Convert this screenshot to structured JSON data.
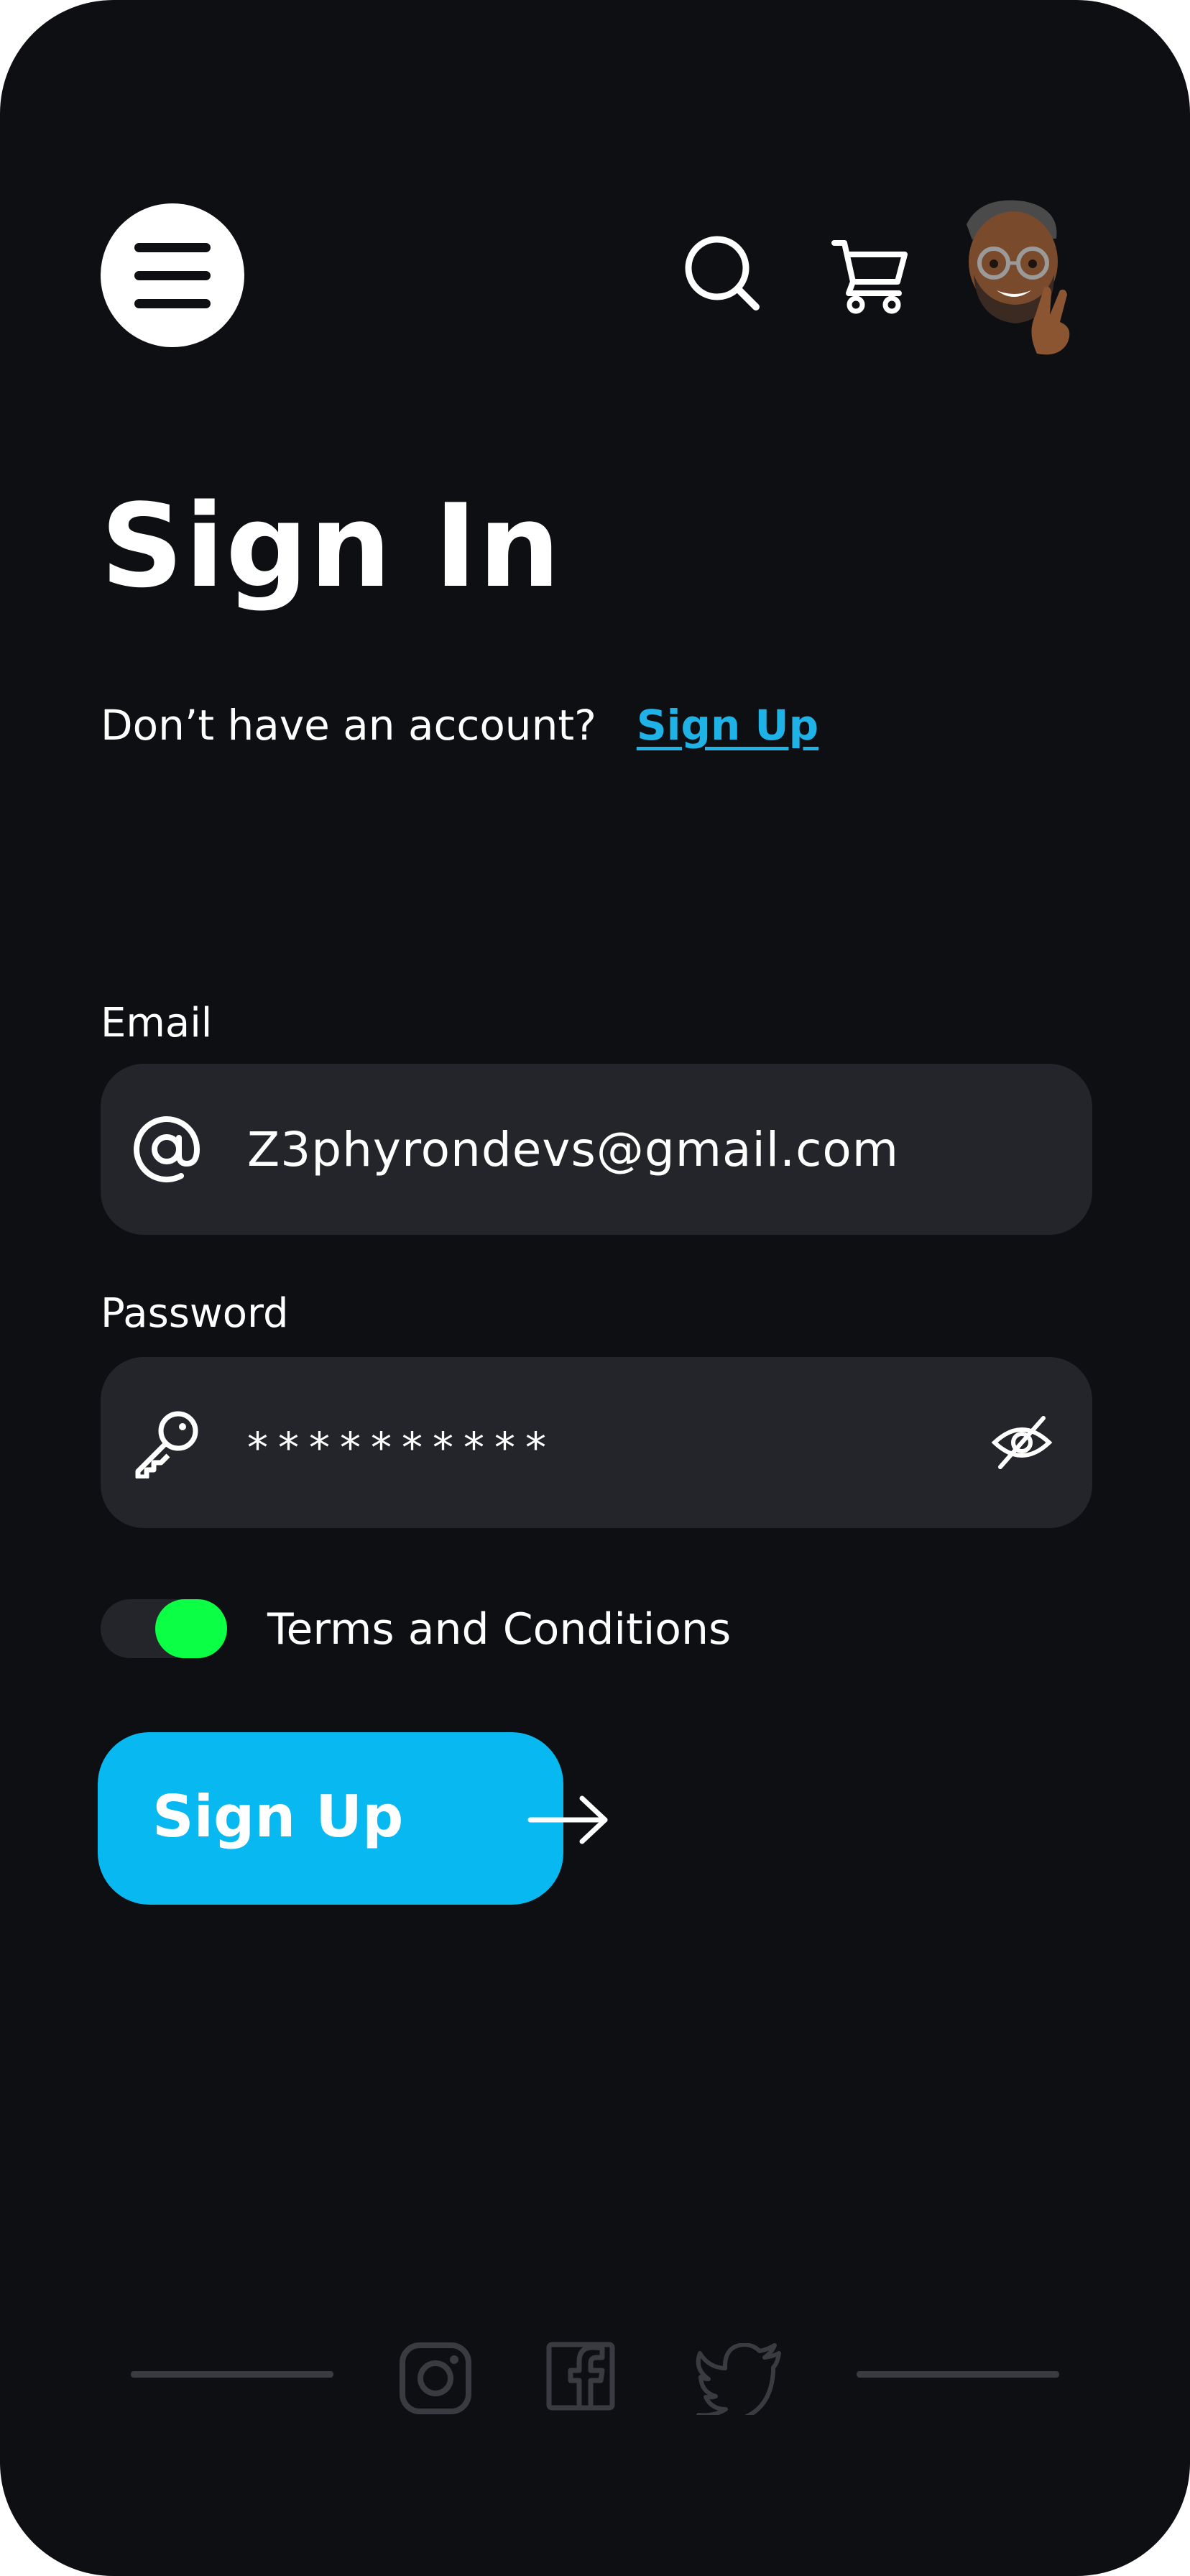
{
  "header": {
    "menu_icon": "hamburger-menu-icon",
    "search_icon": "search-icon",
    "cart_icon": "shopping-cart-icon",
    "avatar_icon": "memoji-avatar-peace-sign"
  },
  "main": {
    "title": "Sign In",
    "prompt_text": "Don’t have an account?",
    "signup_link": "Sign Up"
  },
  "form": {
    "email": {
      "label": "Email",
      "icon": "at-sign-icon",
      "value": "Z3phyrondevs@gmail.com"
    },
    "password": {
      "label": "Password",
      "icon": "key-icon",
      "value": "**********",
      "visibility_icon": "eye-off-icon"
    },
    "terms": {
      "label": "Terms and Conditions",
      "checked": true
    },
    "submit": {
      "label": "Sign Up",
      "icon": "arrow-right-icon"
    }
  },
  "footer": {
    "social_icons": [
      "instagram-icon",
      "facebook-icon",
      "twitter-icon"
    ]
  },
  "colors": {
    "background": "#0e0f13",
    "field_background": "#24252a",
    "link": "#1fb2e6",
    "button": "#08b9f1",
    "toggle_on": "#0bff45",
    "footer_icons": "#3a3b40"
  }
}
